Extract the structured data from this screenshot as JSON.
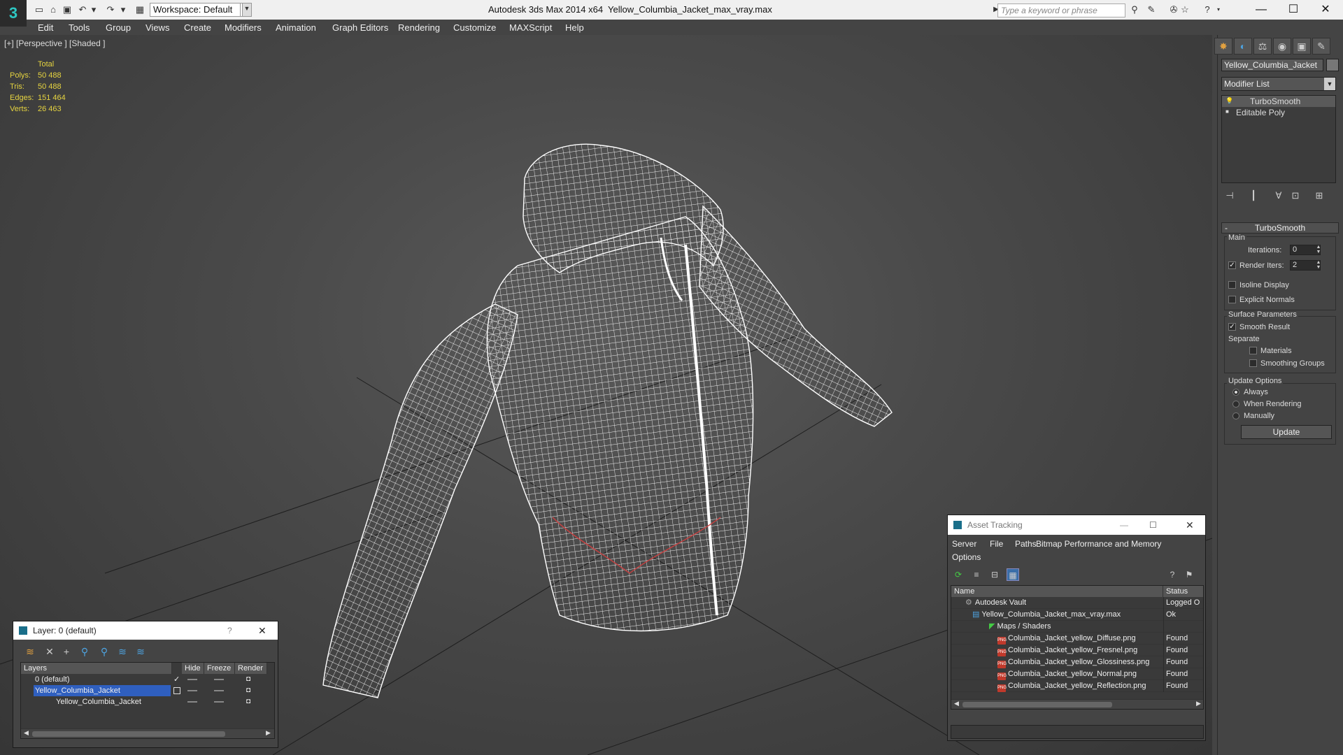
{
  "titlebar": {
    "app_title": "Autodesk 3ds Max  2014 x64",
    "file_title": "Yellow_Columbia_Jacket_max_vray.max",
    "workspace": "Workspace: Default",
    "search_placeholder": "Type a keyword or phrase"
  },
  "menu": [
    "Edit",
    "Tools",
    "Group",
    "Views",
    "Create",
    "Modifiers",
    "Animation",
    "Graph Editors",
    "Rendering",
    "Customize",
    "MAXScript",
    "Help"
  ],
  "viewport": {
    "label": "[+] [Perspective ] [Shaded ]",
    "stats": {
      "header": "Total",
      "polys_label": "Polys:",
      "polys": "50 488",
      "tris_label": "Tris:",
      "tris": "50 488",
      "edges_label": "Edges:",
      "edges": "151 464",
      "verts_label": "Verts:",
      "verts": "26 463"
    }
  },
  "command_panel": {
    "object_name": "Yellow_Columbia_Jacket",
    "modifier_list": "Modifier List",
    "stack": [
      "TurboSmooth",
      "Editable Poly"
    ],
    "rollout": "TurboSmooth",
    "main_label": "Main",
    "iterations_label": "Iterations:",
    "iterations": "0",
    "render_iters_label": "Render Iters:",
    "render_iters": "2",
    "render_iters_checked": "✓",
    "isoline_label": "Isoline Display",
    "explicit_label": "Explicit Normals",
    "surface_label": "Surface Parameters",
    "smooth_result_label": "Smooth Result",
    "smooth_result_checked": "✓",
    "separate_label": "Separate",
    "materials_label": "Materials",
    "smoothing_groups_label": "Smoothing Groups",
    "update_options_label": "Update Options",
    "always_label": "Always",
    "when_rendering_label": "When Rendering",
    "manually_label": "Manually",
    "update_button": "Update"
  },
  "layer_window": {
    "title": "Layer: 0 (default)",
    "help": "?",
    "close": "✕",
    "headers": [
      "Layers",
      "Hide",
      "Freeze",
      "Render"
    ],
    "rows": [
      "0 (default)",
      "Yellow_Columbia_Jacket",
      "Yellow_Columbia_Jacket"
    ]
  },
  "asset_window": {
    "title": "Asset Tracking",
    "menu": [
      "Server",
      "File",
      "Paths",
      "Bitmap Performance and Memory",
      "Options"
    ],
    "headers": [
      "Name",
      "Status"
    ],
    "rows": [
      {
        "name": "Autodesk Vault",
        "status": "Logged O"
      },
      {
        "name": "Yellow_Columbia_Jacket_max_vray.max",
        "status": "Ok"
      },
      {
        "name": "Maps / Shaders",
        "status": ""
      },
      {
        "name": "Columbia_Jacket_yellow_Diffuse.png",
        "status": "Found"
      },
      {
        "name": "Columbia_Jacket_yellow_Fresnel.png",
        "status": "Found"
      },
      {
        "name": "Columbia_Jacket_yellow_Glossiness.png",
        "status": "Found"
      },
      {
        "name": "Columbia_Jacket_yellow_Normal.png",
        "status": "Found"
      },
      {
        "name": "Columbia_Jacket_yellow_Reflection.png",
        "status": "Found"
      }
    ]
  },
  "icons": {
    "logo": "3ds-max-logo",
    "png": "PNG"
  }
}
